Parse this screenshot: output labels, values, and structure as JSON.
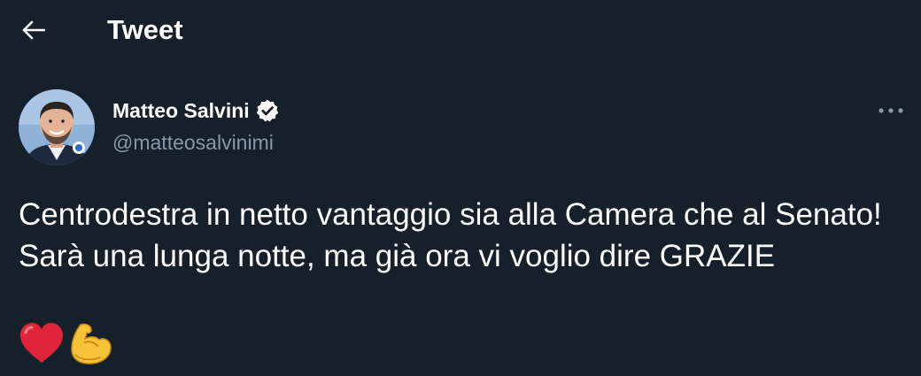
{
  "header": {
    "title": "Tweet",
    "back_icon": "arrow-left-icon"
  },
  "tweet": {
    "author": {
      "name": "Matteo Salvini",
      "handle": "@matteosalvinimi",
      "verified": true,
      "verified_icon": "verified-badge-icon",
      "avatar_icon": "avatar-photo"
    },
    "more_icon": "more-horizontal-icon",
    "text": "Centrodestra in netto vantaggio sia alla Camera che al Senato!\nSarà una lunga notte, ma già ora vi voglio dire GRAZIE",
    "emojis": [
      "red-heart-emoji",
      "flexed-biceps-emoji"
    ]
  },
  "colors": {
    "background": "#15202b",
    "primary_text": "#ffffff",
    "secondary_text": "#8b98a5",
    "heart": "#e0243a",
    "biceps": "#f7c33a"
  }
}
